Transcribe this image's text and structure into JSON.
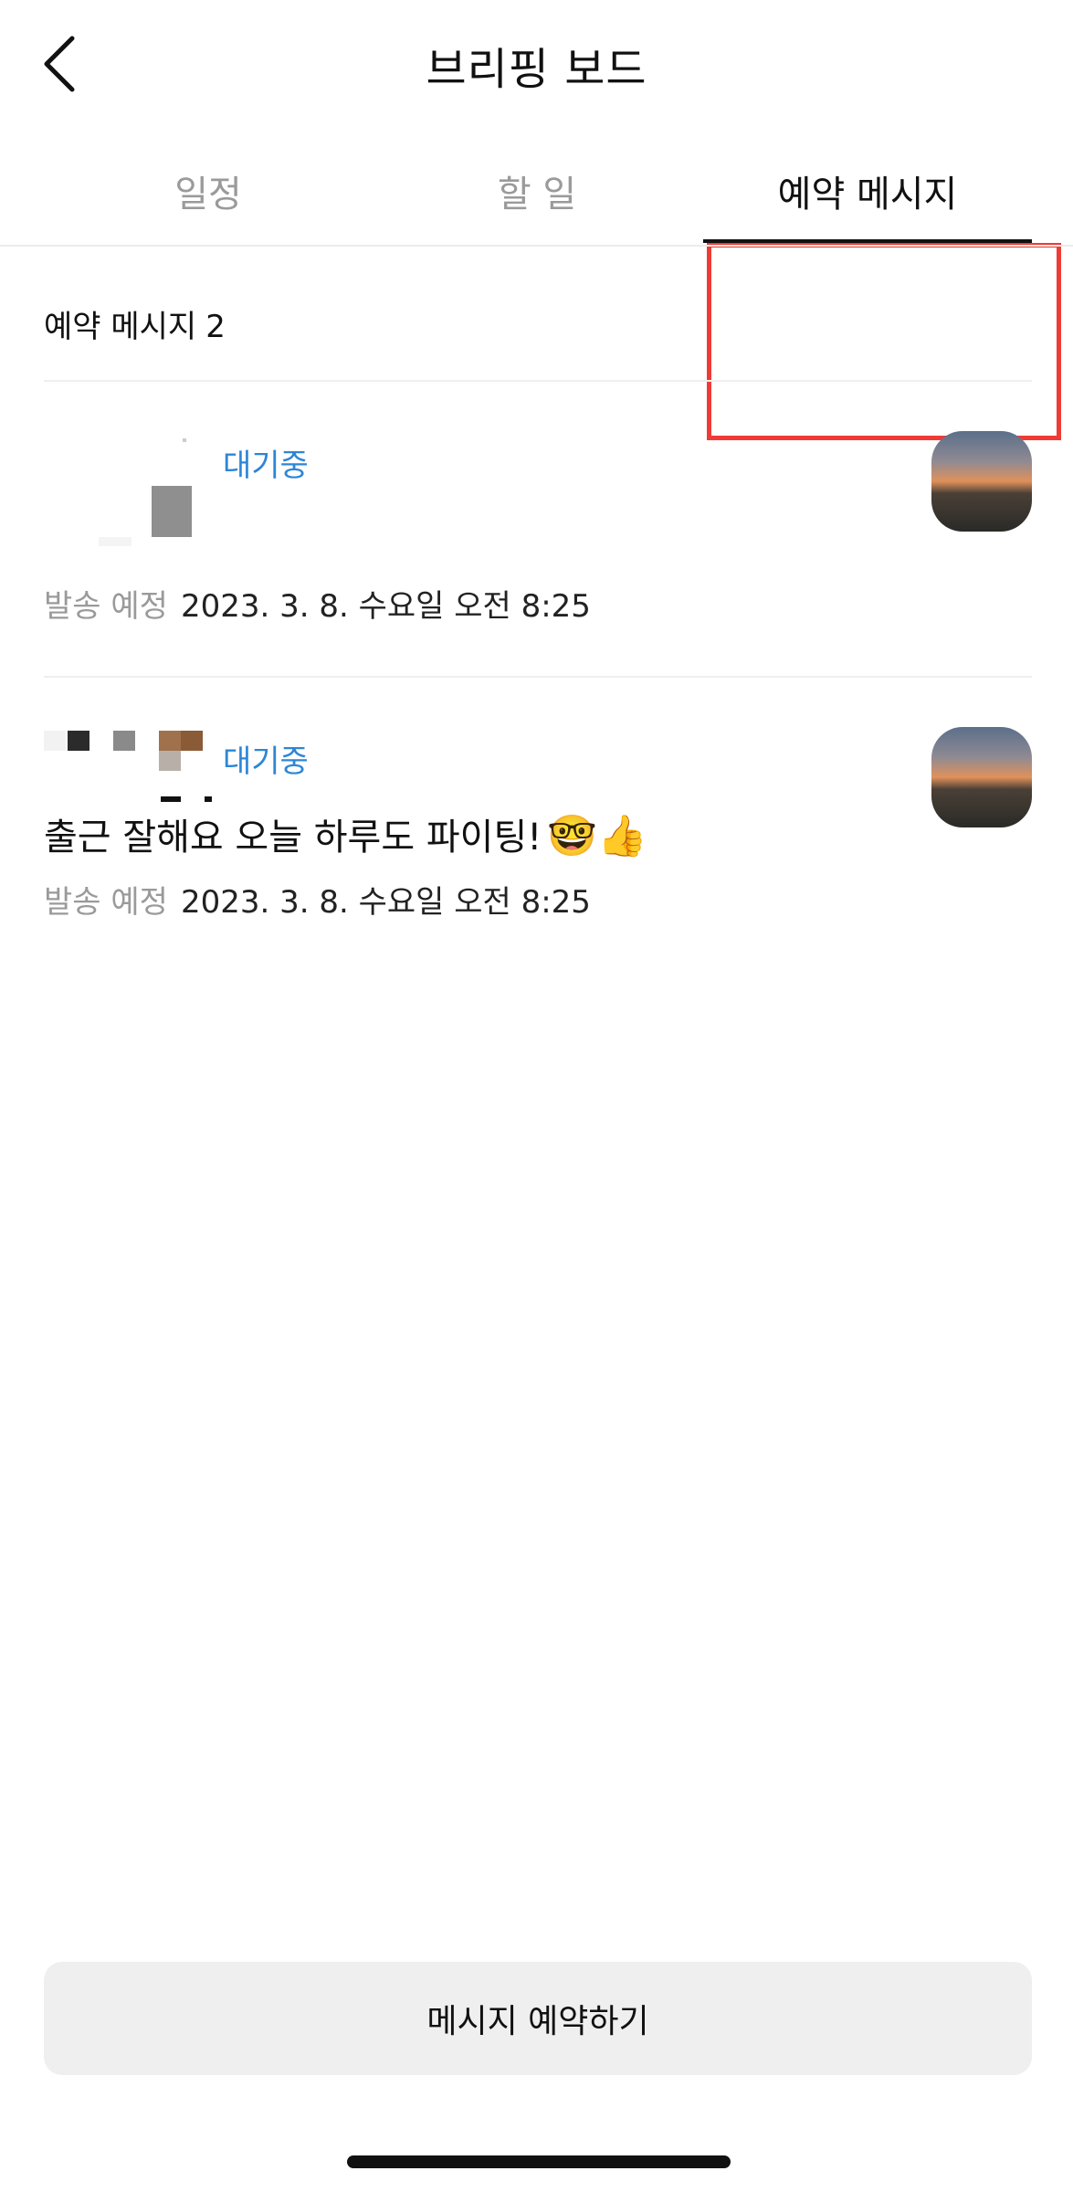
{
  "header": {
    "title": "브리핑 보드",
    "back_icon": "chevron-left-icon"
  },
  "tabs": [
    {
      "label": "일정",
      "active": false
    },
    {
      "label": "할 일",
      "active": false
    },
    {
      "label": "예약 메시지",
      "active": true
    }
  ],
  "highlight_color": "#ee3b35",
  "section": {
    "title": "예약 메시지",
    "count": "2"
  },
  "messages": [
    {
      "status": "대기중",
      "text": "",
      "emoji": "",
      "schedule_label": "발송 예정",
      "schedule_value": "2023. 3. 8. 수요일 오전 8:25"
    },
    {
      "status": "대기중",
      "text": "출근 잘해요 오늘 하루도 파이팅!",
      "emoji": "🤓👍",
      "schedule_label": "발송 예정",
      "schedule_value": "2023. 3. 8. 수요일 오전 8:25"
    }
  ],
  "status_color": "#2d86d6",
  "footer": {
    "reserve_button_label": "메시지 예약하기"
  }
}
